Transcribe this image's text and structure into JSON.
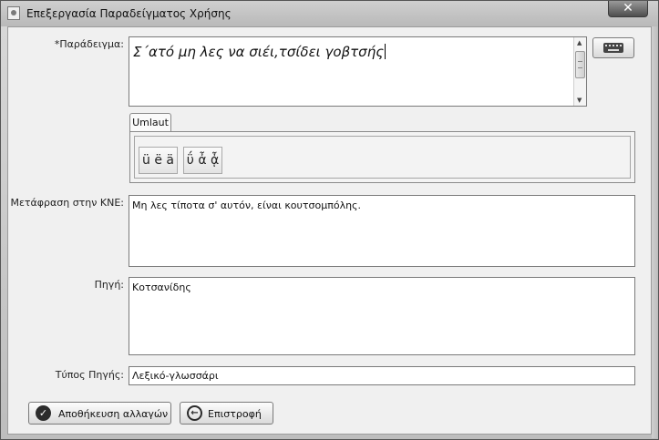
{
  "window": {
    "title": "Επεξεργασία Παραδείγματος Χρήσης",
    "close_glyph": "✕",
    "icon": "java-app-icon"
  },
  "form": {
    "example": {
      "label": "*Παράδειγμα:",
      "value": "Σ΄ατό μη λες να σιέι,τσίδει γοβτσής"
    },
    "keyboard_button": {
      "icon": "keyboard-icon"
    },
    "tabs": [
      {
        "label": "Umlaut"
      }
    ],
    "char_buttons": [
      {
        "label": "ü ë ä"
      },
      {
        "label": "ΰ ἆ ᾆ"
      }
    ],
    "translation": {
      "label": "Μετάφραση στην ΚΝΕ:",
      "value": "Μη λες τίποτα σ' αυτόν, είναι κουτσομπόλης."
    },
    "source": {
      "label": "Πηγή:",
      "value": "Κοτσανίδης"
    },
    "source_type": {
      "label": "Τύπος Πηγής:",
      "value": "Λεξικό-γλωσσάρι"
    }
  },
  "buttons": {
    "save": {
      "label": "Αποθήκευση αλλαγών",
      "icon": "check-circle-icon"
    },
    "back": {
      "label": "Επιστροφή",
      "icon": "back-arrow-circle-icon"
    }
  }
}
